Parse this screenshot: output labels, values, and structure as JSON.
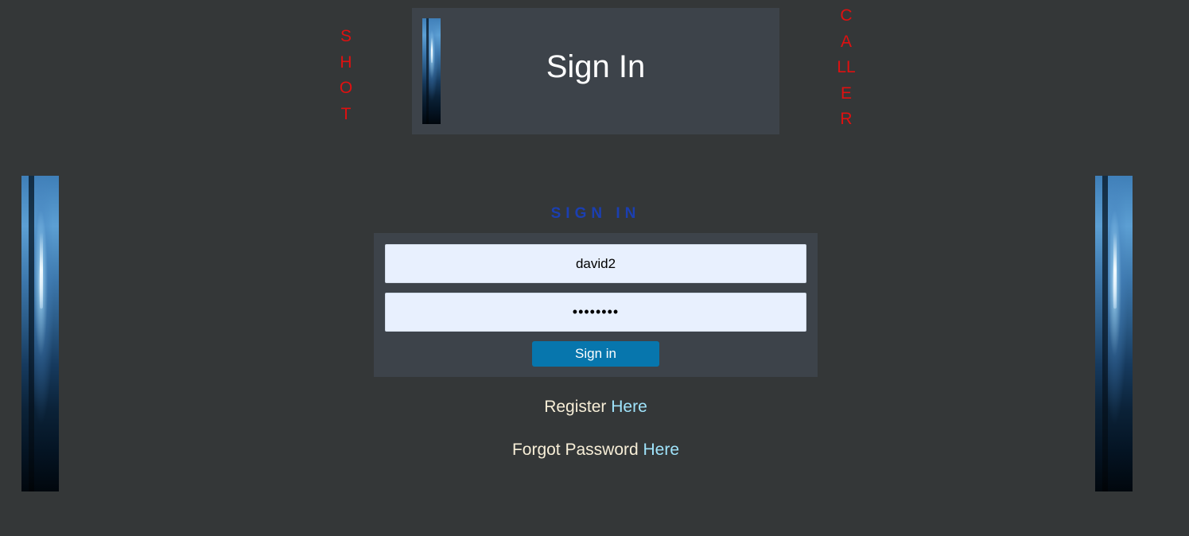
{
  "side_text": {
    "left": "SHOT",
    "right": "CALLER"
  },
  "header": {
    "title": "Sign In"
  },
  "form": {
    "heading": "SIGN IN",
    "username_value": "david2",
    "password_value": "davidpas",
    "submit_label": "Sign in"
  },
  "links": {
    "register_text": "Register",
    "register_link": "Here",
    "forgot_text": "Forgot Password",
    "forgot_link": "Here"
  },
  "colors": {
    "background": "#343738",
    "panel": "#3d434a",
    "accent_red": "#e01010",
    "heading_blue": "#1b3fb1",
    "button_blue": "#0776ad",
    "link_blue": "#9fe3fb",
    "input_bg": "#e8f0fe"
  }
}
